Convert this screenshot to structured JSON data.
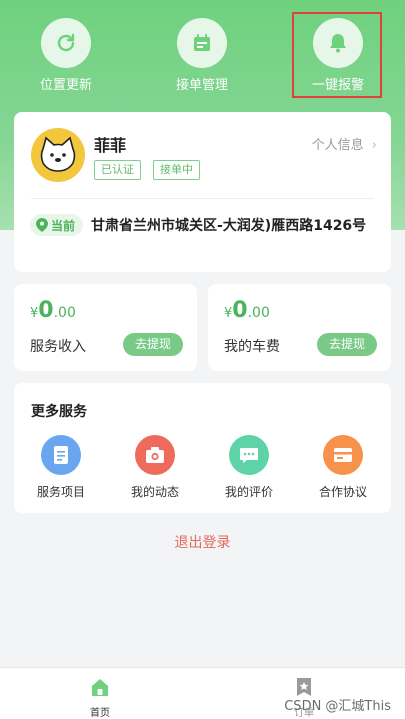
{
  "header": {
    "actions": [
      {
        "label": "位置更新",
        "icon": "refresh-icon"
      },
      {
        "label": "接单管理",
        "icon": "calendar-icon"
      },
      {
        "label": "一键报警",
        "icon": "bell-icon"
      }
    ]
  },
  "profile": {
    "name": "菲菲",
    "tags": [
      "已认证",
      "接单中"
    ],
    "info_link": "个人信息",
    "location_label": "当前",
    "address": "甘肃省兰州市城关区-大润发)雁西路1426号"
  },
  "wallet": {
    "service_income": {
      "currency": "¥",
      "integer": "0",
      "decimal": ".00",
      "label": "服务收入",
      "action": "去提现"
    },
    "car_fee": {
      "currency": "¥",
      "integer": "0",
      "decimal": ".00",
      "label": "我的车费",
      "action": "去提现"
    }
  },
  "services": {
    "title": "更多服务",
    "items": [
      {
        "label": "服务项目",
        "icon": "document-icon",
        "color": "#6aa6f0"
      },
      {
        "label": "我的动态",
        "icon": "camera-icon",
        "color": "#ee6a5b"
      },
      {
        "label": "我的评价",
        "icon": "chat-icon",
        "color": "#5fd3a8"
      },
      {
        "label": "合作协议",
        "icon": "card-icon",
        "color": "#f7924a"
      }
    ]
  },
  "logout": "退出登录",
  "nav": {
    "items": [
      {
        "label": "首页",
        "icon": "home-icon"
      },
      {
        "label": "订单",
        "icon": "star-bookmark-icon"
      }
    ]
  },
  "watermark": "CSDN @汇城This",
  "colors": {
    "primary": "#6fd17e",
    "alarm_border": "#e0413a",
    "logout": "#e46a5e"
  }
}
